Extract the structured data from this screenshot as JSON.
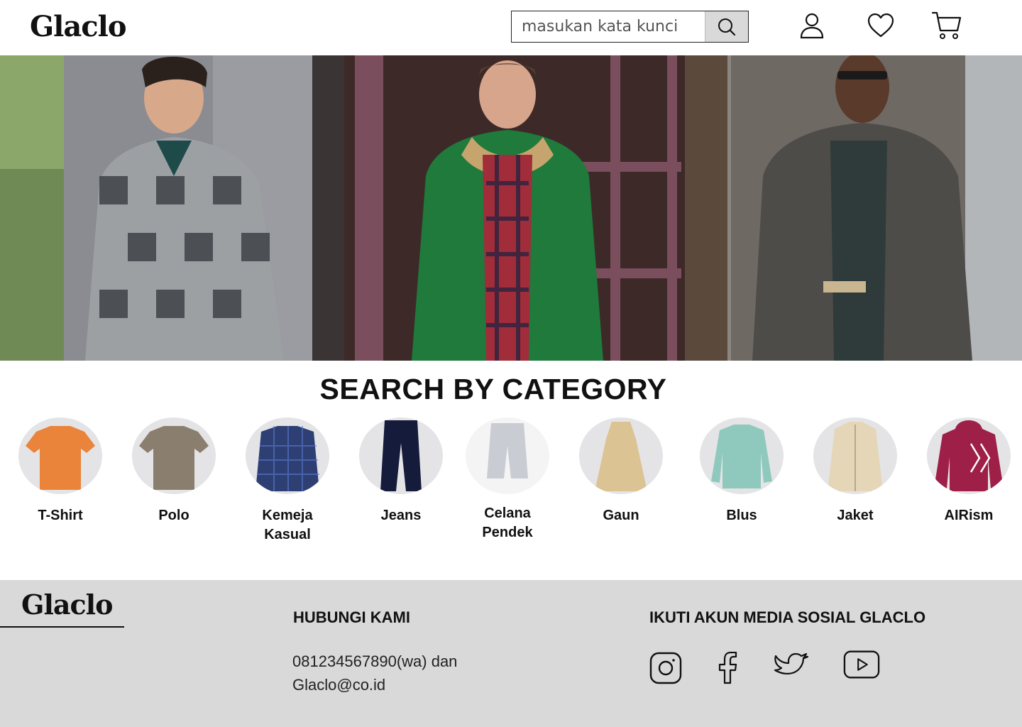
{
  "header": {
    "logo": "Glaclo",
    "search_placeholder": "masukan kata kunci",
    "icons": [
      "search-icon",
      "user-icon",
      "heart-icon",
      "cart-icon"
    ]
  },
  "hero": {
    "description_icons": "banner-photo"
  },
  "category": {
    "title": "SEARCH BY CATEGORY",
    "items": [
      {
        "label": "T-Shirt",
        "color": "#e9843a"
      },
      {
        "label": "Polo",
        "color": "#8a7f6e"
      },
      {
        "label": "Kemeja Kasual",
        "color": "#2d3f73"
      },
      {
        "label": "Jeans",
        "color": "#151b3b"
      },
      {
        "label": "Celana Pendek",
        "color": "#c9ccd2"
      },
      {
        "label": "Gaun",
        "color": "#dcc394"
      },
      {
        "label": "Blus",
        "color": "#8fc9bd"
      },
      {
        "label": "Jaket",
        "color": "#e6d6b8"
      },
      {
        "label": "AIRism",
        "color": "#9e1f47"
      }
    ]
  },
  "footer": {
    "logo": "Glaclo",
    "contact_heading": "HUBUNGI KAMI",
    "contact_text": "081234567890(wa) dan Glaclo@co.id",
    "social_heading": "IKUTI AKUN MEDIA SOSIAL GLACLO",
    "social_icons": [
      "instagram-icon",
      "facebook-icon",
      "twitter-icon",
      "youtube-icon"
    ]
  },
  "colors": {
    "footer_bg": "#d9d9d9",
    "search_button_bg": "#d9d9d9"
  }
}
